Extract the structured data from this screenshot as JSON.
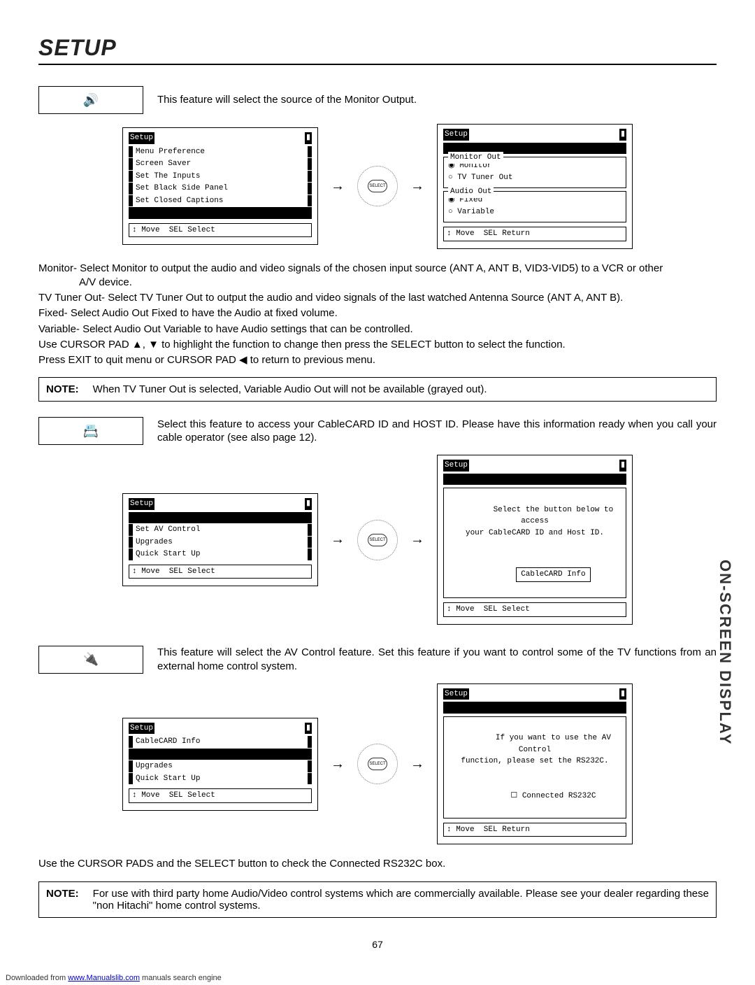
{
  "page_title": "SETUP",
  "side_label": "ON-SCREEN DISPLAY",
  "page_number": "67",
  "footer": {
    "prefix": "Downloaded from ",
    "link": "www.Manualslib.com",
    "suffix": " manuals search engine"
  },
  "section1": {
    "intro": "This feature will select the source of the Monitor Output.",
    "osd_left": {
      "title": "Setup",
      "items": [
        "Menu Preference",
        "Screen Saver",
        "Set The Inputs",
        "Set Black Side Panel",
        "Set Closed Captions"
      ],
      "help": "↕ Move  SEL Select"
    },
    "osd_right": {
      "title": "Setup",
      "group1_label": "Monitor Out",
      "group1_opts": [
        {
          "label": "Monitor",
          "sel": true
        },
        {
          "label": "TV Tuner Out",
          "sel": false
        }
      ],
      "group2_label": "Audio Out",
      "group2_opts": [
        {
          "label": "Fixed",
          "sel": true
        },
        {
          "label": "Variable",
          "sel": false
        }
      ],
      "help": "↕ Move  SEL Return"
    },
    "body": [
      "Monitor- Select Monitor to output the audio and video signals of the chosen input source (ANT A, ANT B, VID3-VID5) to a VCR or other",
      "A/V device.",
      "TV Tuner Out- Select TV Tuner Out to output the audio and video signals of the last watched Antenna Source (ANT A, ANT B).",
      "Fixed-  Select Audio Out Fixed to have the Audio at fixed volume.",
      "Variable- Select Audio Out Variable to have Audio settings that can be controlled.",
      "Use CURSOR PAD ▲, ▼ to highlight the function to change then press the SELECT button to select the function.",
      "Press EXIT to quit menu or CURSOR PAD ◀ to return to previous menu."
    ],
    "note_label": "NOTE:",
    "note": "When TV Tuner Out is selected, Variable Audio Out will not be available (grayed out)."
  },
  "section2": {
    "intro": "Select this feature to access your CableCARD ID and HOST ID.  Please have this information ready when you call your cable operator (see also page 12).",
    "osd_left": {
      "title": "Setup",
      "items": [
        "Set AV Control",
        "Upgrades",
        "Quick Start Up"
      ],
      "help": "↕ Move  SEL Select"
    },
    "osd_right": {
      "title": "Setup",
      "text": "Select the button below to access\nyour CableCARD ID and Host ID.",
      "button": "CableCARD Info",
      "help": "↕ Move  SEL Select"
    }
  },
  "section3": {
    "intro": "This feature will select the AV Control feature.  Set this feature if you want to control some of the TV functions from an external home control system.",
    "osd_left": {
      "title": "Setup",
      "items": [
        "CableCARD Info",
        "",
        "Upgrades",
        "Quick Start Up"
      ],
      "help": "↕ Move  SEL Select"
    },
    "osd_right": {
      "title": "Setup",
      "text": "If you want to use the AV Control\nfunction, please set the RS232C.",
      "checkbox": "Connected RS232C",
      "help": "↕ Move  SEL Return"
    },
    "body": "Use the CURSOR PADS and the SELECT button to check the Connected RS232C box.",
    "note_label": "NOTE:",
    "note": "For use with third party home Audio/Video control systems which are commercially available.  Please see your dealer regarding these \"non Hitachi\" home control systems."
  },
  "dpad_label": "SELECT"
}
